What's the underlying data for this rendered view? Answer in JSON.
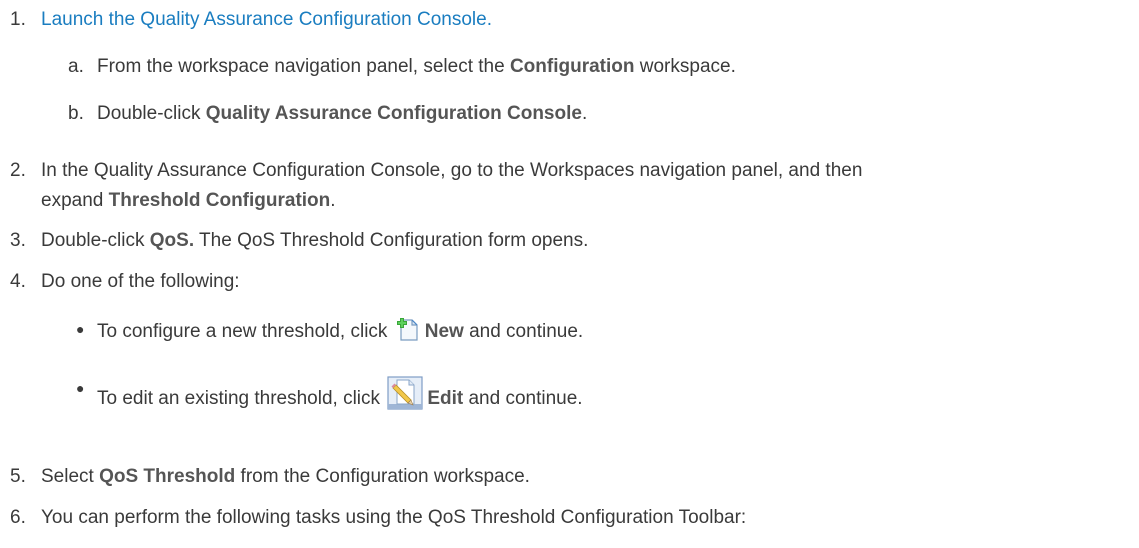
{
  "steps": [
    {
      "num": "1.",
      "link": "Launch the Quality Assurance Configuration Console."
    },
    {
      "num": "2.",
      "prefix": "In the Quality Assurance Configuration Console, go to the Workspaces navigation panel, and then",
      "cont": "expand ",
      "bold": "Threshold Configuration",
      "suffix": "."
    },
    {
      "num": "3.",
      "prefix": "Double-click ",
      "bold": "QoS.",
      "suffix": " The QoS Threshold Configuration form opens."
    },
    {
      "num": "4.",
      "text": "Do one of the following:"
    },
    {
      "num": "5.",
      "prefix": "Select ",
      "bold": "QoS Threshold",
      "suffix": " from the Configuration workspace."
    },
    {
      "num": "6.",
      "text": "You can perform the following tasks using the QoS Threshold Configuration Toolbar:"
    }
  ],
  "substeps": [
    {
      "letter": "a.",
      "prefix": "From the workspace navigation panel, select the ",
      "bold": "Configuration",
      "suffix": " workspace."
    },
    {
      "letter": "b.",
      "prefix": "Double-click ",
      "bold": "Quality Assurance Configuration Console",
      "suffix": "."
    }
  ],
  "bullets": [
    {
      "prefix": "To configure a new threshold, click ",
      "icon": "new-document-icon",
      "bold": "New",
      "suffix": " and continue."
    },
    {
      "prefix": "To edit an existing threshold, click ",
      "icon": "edit-pencil-icon",
      "bold": "Edit",
      "suffix": " and continue."
    }
  ],
  "colors": {
    "link": "#1a7dc0",
    "text": "#3a3a3a"
  }
}
